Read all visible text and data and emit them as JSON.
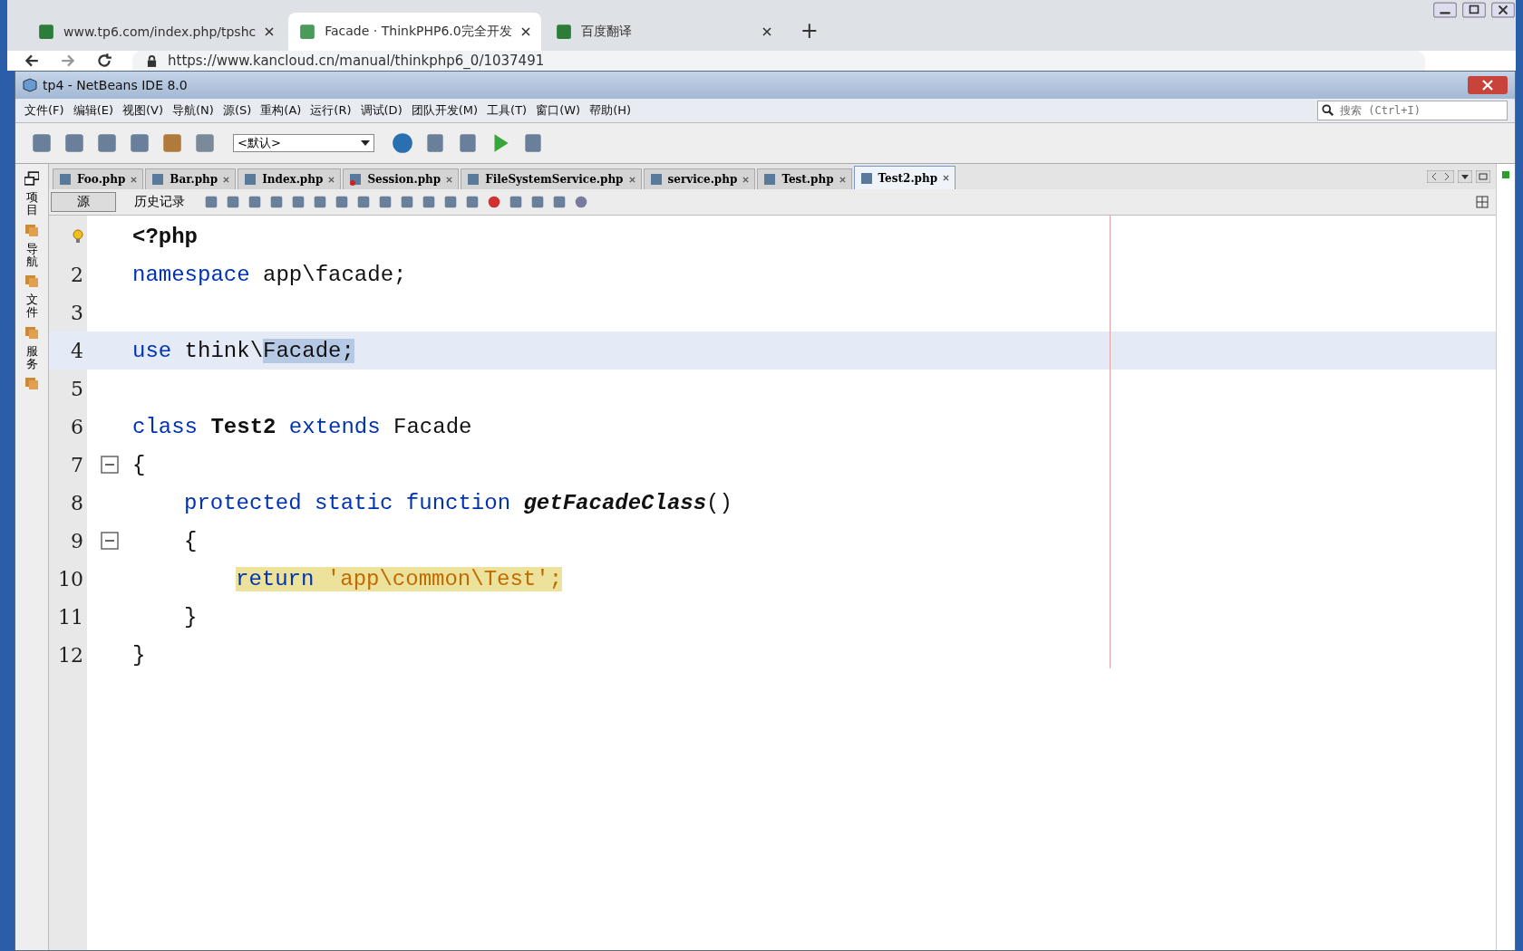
{
  "browser": {
    "tabs": [
      {
        "title": "www.tp6.com/index.php/tpshc",
        "selected": false
      },
      {
        "title": "Facade · ThinkPHP6.0完全开发",
        "selected": true
      },
      {
        "title": "百度翻译",
        "selected": false
      }
    ],
    "new_tab": "+",
    "address": "https://www.kancloud.cn/manual/thinkphp6_0/1037491"
  },
  "window": {
    "title": "tp4 - NetBeans IDE 8.0"
  },
  "menu": [
    "文件(F)",
    "编辑(E)",
    "视图(V)",
    "导航(N)",
    "源(S)",
    "重构(A)",
    "运行(R)",
    "调试(D)",
    "团队开发(M)",
    "工具(T)",
    "窗口(W)",
    "帮助(H)"
  ],
  "search": {
    "placeholder": "搜索 (Ctrl+I)"
  },
  "config": {
    "value": "<默认>"
  },
  "side_panels": [
    "项目",
    "导航",
    "文件",
    "服务"
  ],
  "editor_tabs": [
    {
      "label": "Foo.php",
      "selected": false,
      "error": false
    },
    {
      "label": "Bar.php",
      "selected": false,
      "error": false
    },
    {
      "label": "Index.php",
      "selected": false,
      "error": false
    },
    {
      "label": "Session.php",
      "selected": false,
      "error": true
    },
    {
      "label": "FileSystemService.php",
      "selected": false,
      "error": false
    },
    {
      "label": "service.php",
      "selected": false,
      "error": false
    },
    {
      "label": "Test.php",
      "selected": false,
      "error": false
    },
    {
      "label": "Test2.php",
      "selected": true,
      "error": false
    }
  ],
  "view_tabs": [
    {
      "label": "源",
      "selected": true
    },
    {
      "label": "历史记录",
      "selected": false
    }
  ],
  "code": [
    {
      "hint": true,
      "fold": false,
      "current": false,
      "tokens": [
        {
          "kind": "bold",
          "text": "<?php"
        }
      ]
    },
    {
      "number": "2",
      "hint": false,
      "fold": false,
      "current": false,
      "tokens": [
        {
          "kind": "keyword",
          "text": "namespace"
        },
        {
          "kind": "plain",
          "text": " app\\facade;"
        }
      ]
    },
    {
      "number": "3",
      "hint": false,
      "fold": false,
      "current": false
    },
    {
      "number": "4",
      "hint": false,
      "fold": false,
      "current": true,
      "tokens": [
        {
          "kind": "keyword",
          "text": "use"
        },
        {
          "kind": "plain",
          "text": " think\\"
        },
        {
          "kind": "selection",
          "text": "Facade;"
        }
      ]
    },
    {
      "number": "5",
      "hint": false,
      "fold": false,
      "current": false
    },
    {
      "number": "6",
      "hint": false,
      "fold": false,
      "current": false,
      "tokens": [
        {
          "kind": "keyword",
          "text": "class "
        },
        {
          "kind": "bold",
          "text": "Test2 "
        },
        {
          "kind": "keyword",
          "text": "extends "
        },
        {
          "kind": "plain",
          "text": "Facade"
        }
      ]
    },
    {
      "number": "7",
      "hint": false,
      "fold": true,
      "current": false,
      "tokens": [
        {
          "kind": "plain",
          "text": "{"
        }
      ],
      "children": [
        {
          "number": "8",
          "hint": false,
          "fold": false,
          "current": false,
          "tokens": [
            {
              "kind": "keyword",
              "text": "protected static function "
            },
            {
              "kind": "method",
              "text": "getFacadeClass"
            },
            {
              "kind": "plain",
              "text": "()"
            }
          ]
        },
        {
          "number": "9",
          "hint": false,
          "fold": true,
          "current": false,
          "tokens": [
            {
              "kind": "plain",
              "text": "{"
            }
          ],
          "children": [
            {
              "number": "10",
              "hint": false,
              "fold": false,
              "current": false,
              "tokens": [
                {
                  "kind": "marked-keyword",
                  "text": "return "
                },
                {
                  "kind": "marked-string",
                  "text": "'app\\common\\Test';"
                }
              ]
            }
          ]
        },
        {
          "number": "11",
          "hint": false,
          "fold": false,
          "current": false,
          "tokens": [
            {
              "kind": "plain",
              "text": "}"
            }
          ]
        }
      ]
    },
    {
      "number": "12",
      "hint": false,
      "fold": false,
      "current": false,
      "tokens": [
        {
          "kind": "plain",
          "text": "}"
        }
      ]
    }
  ]
}
